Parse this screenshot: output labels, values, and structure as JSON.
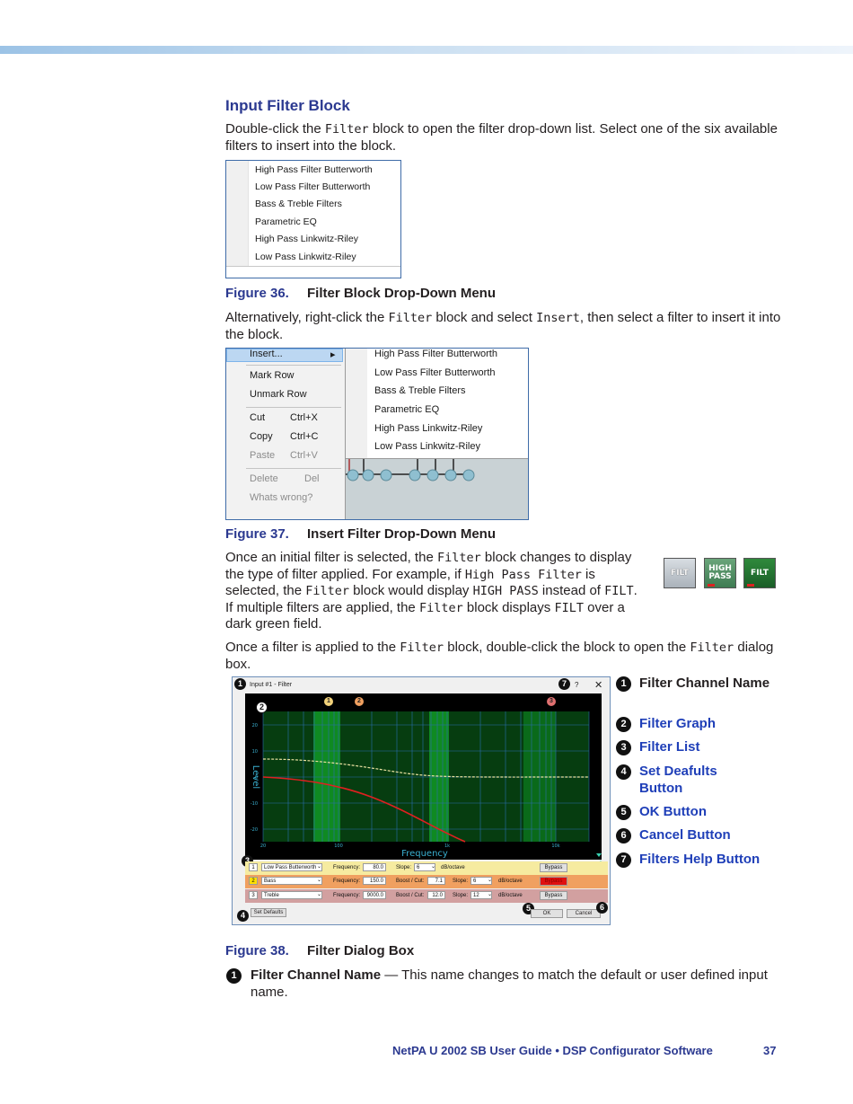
{
  "section_title": "Input Filter Block",
  "p1": {
    "a": "Double-click the ",
    "code": "Filter",
    "b": " block to open the filter drop-down list. Select one of the six available filters to insert into the block."
  },
  "fig36": {
    "items": [
      "High Pass Filter Butterworth",
      "Low Pass Filter Butterworth",
      "Bass & Treble Filters",
      "Parametric EQ",
      "High Pass Linkwitz-Riley",
      "Low Pass Linkwitz-Riley"
    ],
    "num": "Figure 36.",
    "caption": "Filter Block Drop-Down Menu"
  },
  "p2": {
    "a": "Alternatively, right-click the ",
    "code1": "Filter",
    "b": " block and select ",
    "code2": "Insert",
    "c": ", then select a filter to insert it into the block."
  },
  "fig37": {
    "menu": {
      "insert": "Insert...",
      "arrow": "▸",
      "mark": "Mark Row",
      "unmark": "Unmark Row",
      "cut": "Cut",
      "cut_sc": "Ctrl+X",
      "copy": "Copy",
      "copy_sc": "Ctrl+C",
      "paste": "Paste",
      "paste_sc": "Ctrl+V",
      "delete": "Delete",
      "delete_sc": "Del",
      "whats": "Whats wrong?"
    },
    "submenu": [
      "High Pass Filter Butterworth",
      "Low Pass Filter Butterworth",
      "Bass & Treble Filters",
      "Parametric EQ",
      "High Pass Linkwitz-Riley",
      "Low Pass Linkwitz-Riley"
    ],
    "num": "Figure 37.",
    "caption": "Insert Filter Drop-Down Menu"
  },
  "p3": {
    "a": "Once an initial filter is selected, the ",
    "c1": "Filter",
    "b": " block changes to display the type of filter applied. For example, if ",
    "c2": "High Pass Filter",
    "c": " is selected, the ",
    "c3": "Filter",
    "d": "  block would display ",
    "c4": "HIGH PASS",
    "e": " instead of ",
    "c5": "FILT",
    "f": ". If multiple filters are applied, the ",
    "c6": "Filter",
    "g": " block displays ",
    "c7": "FILT",
    "h": " over a dark green field."
  },
  "badges": {
    "b1": "FILT",
    "b2a": "HIGH",
    "b2b": "PASS",
    "b3": "FILT"
  },
  "p4": {
    "a": "Once a filter is applied to the ",
    "c1": "Filter",
    "b": " block, double-click the block to open the ",
    "c2": "Filter",
    "c": " dialog box."
  },
  "dialog": {
    "title": "Input #1 - Filter",
    "help": "?",
    "close": "✕",
    "graph": {
      "ylabel": "Level",
      "xlabel": "Frequency",
      "yticks": [
        "20",
        "10",
        "0",
        "-10",
        "-20"
      ],
      "xticks": [
        "20",
        "100",
        "1k",
        "10k"
      ]
    },
    "rows": [
      {
        "index": "1",
        "filter": "Low Pass Butterworth",
        "freq_label": "Frequency:",
        "freq": "80.0",
        "slope_label": "Slope:",
        "slope": "6",
        "unit": "dB/octave",
        "bypass": "Bypass"
      },
      {
        "index": "2",
        "filter": "Bass",
        "freq_label": "Frequency:",
        "freq": "150.0",
        "boost_label": "Boost / Cut:",
        "boost": "7.1",
        "slope_label": "Slope:",
        "slope": "6",
        "unit": "dB/octave",
        "bypass": "Bypass"
      },
      {
        "index": "3",
        "filter": "Treble",
        "freq_label": "Frequency:",
        "freq": "9000.0",
        "boost_label": "Boost / Cut:",
        "boost": "12.0",
        "slope_label": "Slope:",
        "slope": "12",
        "unit": "dB/octave",
        "bypass": "Bypass"
      }
    ],
    "set_defaults": "Set Defaults",
    "ok": "OK",
    "cancel": "Cancel",
    "callouts": [
      "1",
      "2",
      "3",
      "4",
      "5",
      "6",
      "7"
    ]
  },
  "legend": [
    {
      "n": "1",
      "text": "Filter Channel Name",
      "color": "#231f20"
    },
    {
      "n": "2",
      "text": "Filter Graph",
      "color": "#1f3fb8"
    },
    {
      "n": "3",
      "text": "Filter List",
      "color": "#1f3fb8"
    },
    {
      "n": "4",
      "text": "Set Deafults Button",
      "color": "#1f3fb8"
    },
    {
      "n": "5",
      "text": "OK Button",
      "color": "#1f3fb8"
    },
    {
      "n": "6",
      "text": "Cancel Button",
      "color": "#1f3fb8"
    },
    {
      "n": "7",
      "text": "Filters Help Button",
      "color": "#1f3fb8"
    }
  ],
  "fig38": {
    "num": "Figure 38.",
    "caption": "Filter Dialog Box"
  },
  "desc1": {
    "n": "1",
    "term": "Filter Channel Name",
    "text": " — This name changes to match the default or user defined input name."
  },
  "footer": {
    "title": "NetPA U 2002 SB User Guide • DSP Configurator Software",
    "page": "37"
  }
}
